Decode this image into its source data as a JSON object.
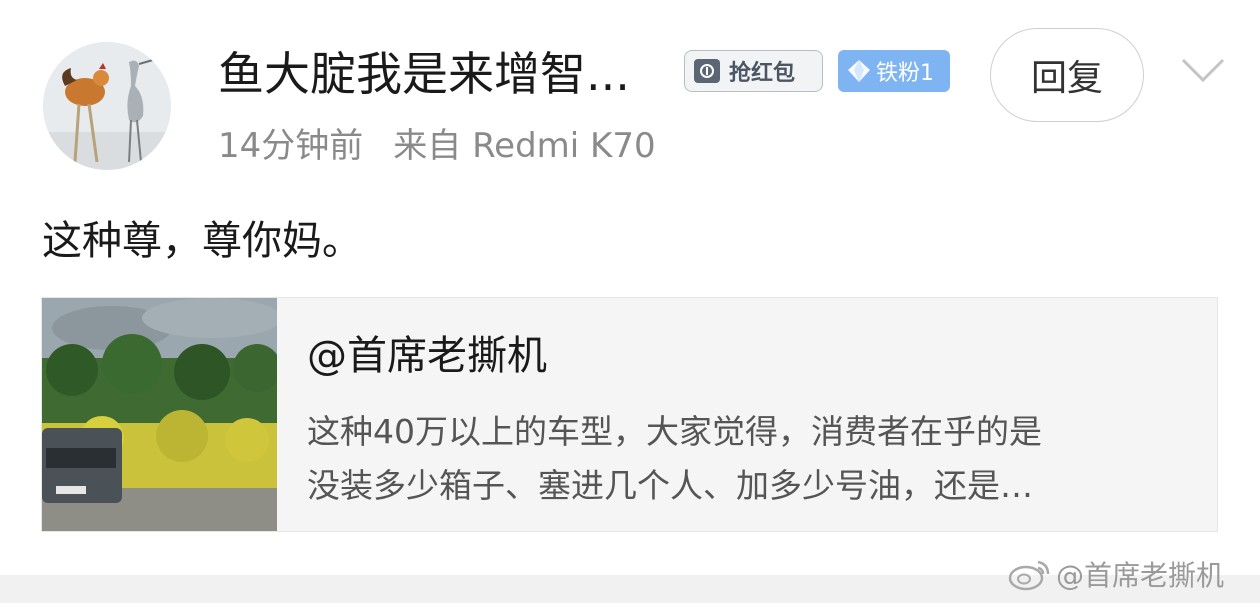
{
  "comment": {
    "username": "鱼大腚我是来增智...",
    "badges": {
      "red_packet_label": "抢红包",
      "fan_label": "铁粉1"
    },
    "reply_label": "回复",
    "time": "14分钟前",
    "source": "来自 Redmi K70",
    "text": "这种尊，尊你妈。"
  },
  "quoted_card": {
    "title": "@首席老撕机",
    "line1": "这种40万以上的车型，大家觉得，消费者在乎的是",
    "line2": "没装多少箱子、塞进几个人、加多少号油，还是…"
  },
  "watermark": "@首席老撕机",
  "colors": {
    "fan_badge": "#7fb4f3",
    "meta_text": "#8a8a8a",
    "card_bg": "#f5f5f5"
  },
  "icons": [
    "red-packet-icon",
    "diamond-icon",
    "chevron-down-icon",
    "weibo-logo-icon"
  ]
}
